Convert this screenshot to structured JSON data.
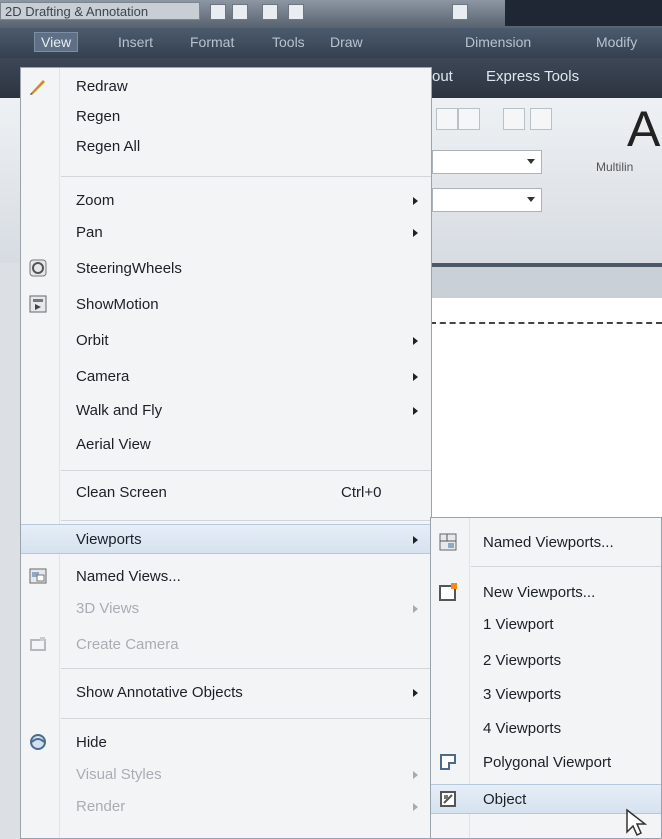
{
  "titlebar": {
    "workspace": "2D Drafting & Annotation"
  },
  "menubar": [
    "View",
    "Insert",
    "Format",
    "Tools",
    "Draw",
    "Dimension",
    "Modify"
  ],
  "ribbon": {
    "tabs": [
      "out",
      "Express Tools"
    ],
    "multiline_label": "Multilin",
    "text_a": "A"
  },
  "view_menu": {
    "items": [
      {
        "label": "Redraw",
        "icon": "pencil-icon"
      },
      {
        "label": "Regen"
      },
      {
        "label": "Regen All"
      },
      {
        "label": "Zoom",
        "submenu": true
      },
      {
        "label": "Pan",
        "submenu": true
      },
      {
        "label": "SteeringWheels",
        "icon": "steeringwheel-icon"
      },
      {
        "label": "ShowMotion",
        "icon": "showmotion-icon"
      },
      {
        "label": "Orbit",
        "submenu": true
      },
      {
        "label": "Camera",
        "submenu": true
      },
      {
        "label": "Walk and Fly",
        "submenu": true
      },
      {
        "label": "Aerial View"
      },
      {
        "label": "Clean Screen",
        "shortcut": "Ctrl+0"
      },
      {
        "label": "Viewports",
        "submenu": true,
        "highlighted": true
      },
      {
        "label": "Named Views...",
        "icon": "named-views-icon"
      },
      {
        "label": "3D Views",
        "submenu": true,
        "disabled": true
      },
      {
        "label": "Create Camera",
        "icon": "camera-icon",
        "disabled": true
      },
      {
        "label": "Show Annotative Objects",
        "submenu": true
      },
      {
        "label": "Hide",
        "icon": "hide-icon"
      },
      {
        "label": "Visual Styles",
        "submenu": true,
        "disabled": true
      },
      {
        "label": "Render",
        "submenu": true,
        "disabled": true
      }
    ]
  },
  "viewports_submenu": {
    "items": [
      {
        "label": "Named Viewports...",
        "icon": "named-viewports-icon"
      },
      {
        "label": "New Viewports...",
        "icon": "new-viewports-icon"
      },
      {
        "label": "1 Viewport"
      },
      {
        "label": "2 Viewports"
      },
      {
        "label": "3 Viewports"
      },
      {
        "label": "4 Viewports"
      },
      {
        "label": "Polygonal Viewport",
        "icon": "polygonal-viewport-icon"
      },
      {
        "label": "Object",
        "icon": "object-viewport-icon",
        "highlighted": true
      }
    ]
  },
  "colors": {
    "menu_bg": "#f3f4f6",
    "highlight": "#dbe6f2",
    "menubar": "#3d4a5a"
  }
}
